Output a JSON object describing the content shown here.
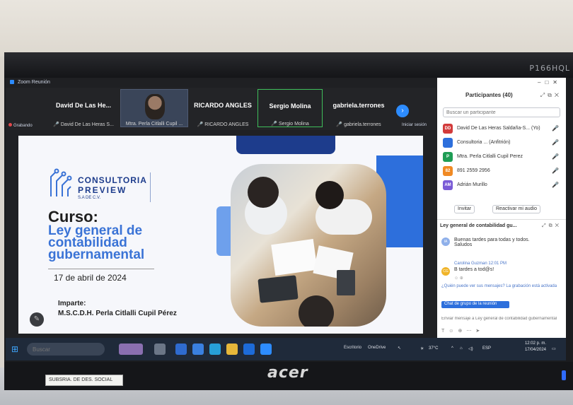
{
  "monitor": {
    "model": "P166HQL",
    "brand": "acer",
    "sticker": "SUBSRIA. DE DES. SOCIAL"
  },
  "window": {
    "title": "Zoom Reunión"
  },
  "participants_strip": {
    "tiles": [
      {
        "big": "David De Las He...",
        "small": "David De Las Heras S..."
      },
      {
        "small": "Mtra. Perla Citlalli Cupil ..."
      },
      {
        "big": "RICARDO ANGLES",
        "small": "RICARDO ANGLES"
      },
      {
        "big": "Sergio Molina",
        "small": "Sergio Molina"
      },
      {
        "big": "gabriela.terrones",
        "small": "gabriela.terrones"
      }
    ],
    "leave_label": "Iniciar sesión",
    "recording_label": "Grabando"
  },
  "slide": {
    "logo_line1": "CONSULTORIA",
    "logo_line2": "PREVIEW",
    "logo_line3": "S.A DE C.V.",
    "curso": "Curso:",
    "course_title": "Ley general de contabilidad gubernamental",
    "date": "17 de abril de 2024",
    "imparte": "Imparte:",
    "instructor": "M.S.C.D.H. Perla Citlalli Cupil Pérez"
  },
  "panel": {
    "title": "Participantes (40)",
    "search_placeholder": "Buscar un participante",
    "participants": [
      {
        "initials": "DD",
        "color": "#d23b3b",
        "name": "David De Las Heras Saldaña-S... (Yo)"
      },
      {
        "initials": "",
        "color": "#2d6fdc",
        "name": "Consultoria ... (Anfitrión)"
      },
      {
        "initials": "P",
        "color": "#1f9d55",
        "name": "Mtra. Perla Citlalli Cupil Perez"
      },
      {
        "initials": "82",
        "color": "#f08a24",
        "name": "891 2559 2956"
      },
      {
        "initials": "AM",
        "color": "#7a5bd6",
        "name": "Adrián Murillo"
      }
    ],
    "invite_label": "Invitar",
    "reactivate_label": "Reactivar mi audio",
    "chat_title": "Ley general de contabilidad gu...",
    "messages": [
      {
        "initials": "IA",
        "color": "#8fb0ea",
        "from": "",
        "text": "Buenas tardes para todas y todos. Saludos"
      },
      {
        "initials": "CG",
        "color": "#f0b429",
        "from": "Carolina Guzman 12:01 PM",
        "text": "B tardes a tod@s!"
      }
    ],
    "note": "¿Quién puede ver sus mensajes? La grabación está activada",
    "chat_target": "Chat de grupo de la reunión",
    "chat_input_placeholder": "Enviar mensaje a Ley general de contabilidad gubernamental"
  },
  "taskbar": {
    "search_placeholder": "Buscar",
    "desktop_label": "Escritorio",
    "onedrive_label": "OneDrive",
    "temperature": "37°C",
    "language": "ESP",
    "time": "12:02 p. m.",
    "date": "17/04/2024"
  }
}
